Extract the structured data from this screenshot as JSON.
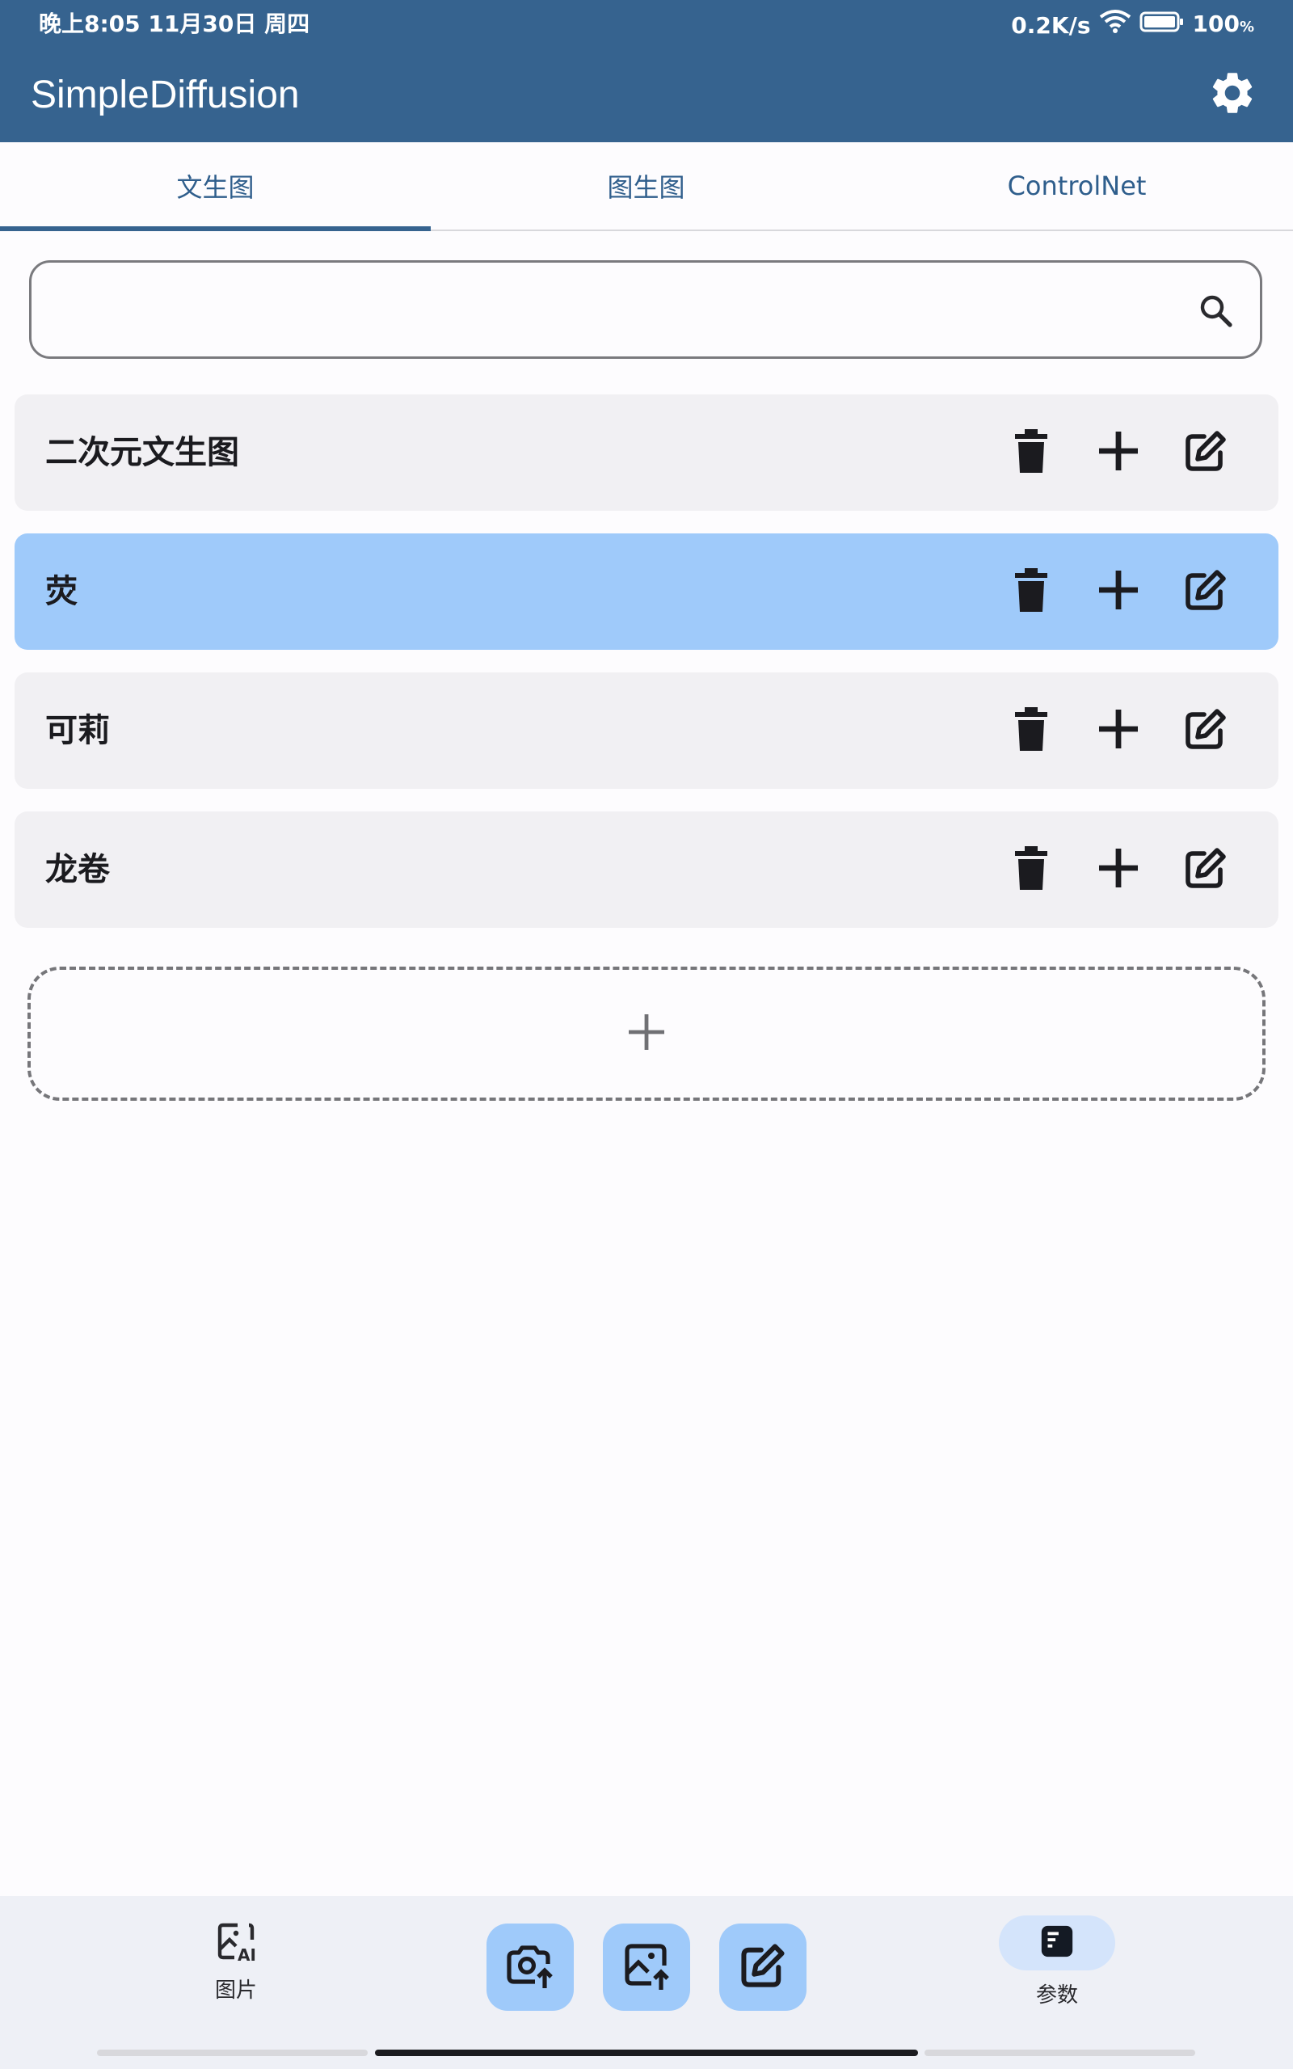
{
  "status_bar": {
    "time": "晚上8:05 11月30日 周四",
    "network_speed": "0.2K/s",
    "battery": "100",
    "battery_unit": "%"
  },
  "app_bar": {
    "title": "SimpleDiffusion",
    "settings_icon": "gear-icon"
  },
  "tabs": [
    {
      "label": "文生图",
      "active": true
    },
    {
      "label": "图生图",
      "active": false
    },
    {
      "label": "ControlNet",
      "active": false
    }
  ],
  "search": {
    "value": "",
    "placeholder": "",
    "icon": "search-icon"
  },
  "list": {
    "items": [
      {
        "label": "二次元文生图",
        "selected": false
      },
      {
        "label": "荧",
        "selected": true
      },
      {
        "label": "可莉",
        "selected": false
      },
      {
        "label": "龙卷",
        "selected": false
      }
    ],
    "add_icon": "plus-icon"
  },
  "bottom_nav": {
    "pictures_label": "图片",
    "params_label": "参数",
    "fab_icons": [
      "camera-upload-icon",
      "image-upload-icon",
      "pencil-icon"
    ]
  },
  "colors": {
    "primary": "#36638f",
    "selected_item": "#9fcafa",
    "item_background": "#f1f0f3"
  }
}
